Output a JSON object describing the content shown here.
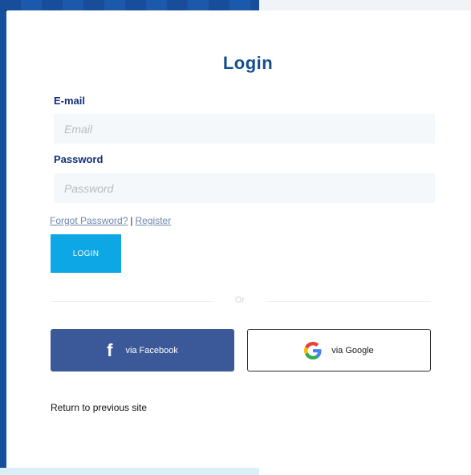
{
  "login": {
    "title": "Login",
    "email_label": "E-mail",
    "email_placeholder": "Email",
    "email_value": "",
    "password_label": "Password",
    "password_placeholder": "Password",
    "password_value": "",
    "forgot_link": "Forgot Password?",
    "separator": "|",
    "register_link": "Register",
    "login_button": "LOGIN",
    "or_text": "Or",
    "facebook_icon": "f",
    "facebook_label": "via Facebook",
    "google_label": "via Google",
    "return_link": "Return to previous site"
  },
  "colors": {
    "accent": "#0ea7e6",
    "title": "#134e8f",
    "facebook": "#3b5998",
    "frame": "#164f9e"
  },
  "icons": {
    "facebook": "facebook-icon",
    "google": "google-icon"
  }
}
